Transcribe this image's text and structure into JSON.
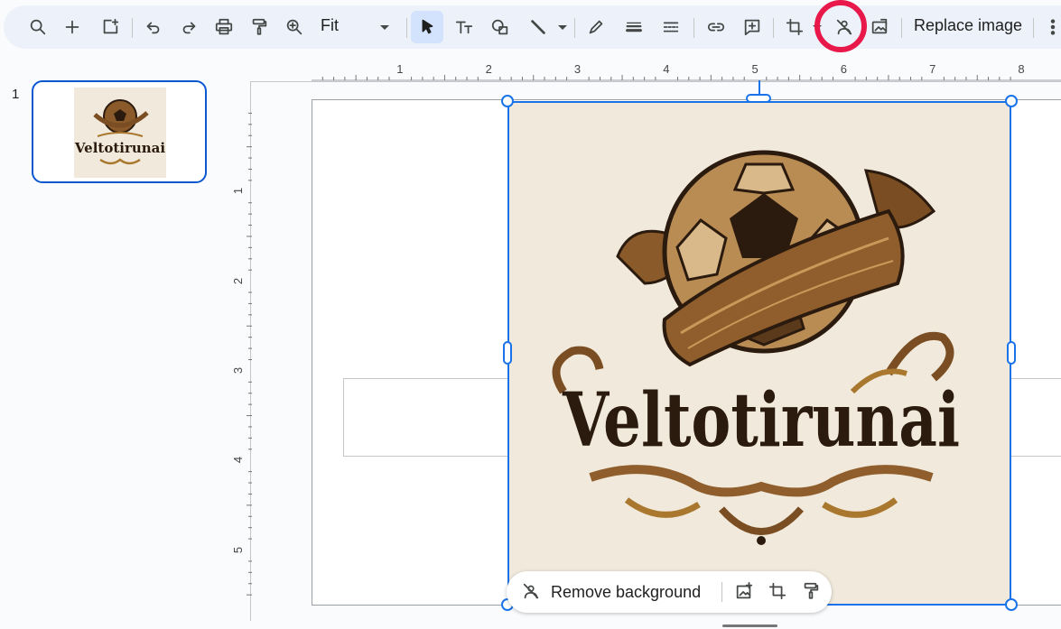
{
  "toolbar": {
    "zoom_value": "Fit",
    "replace_image_label": "Replace image",
    "icons": [
      "search-icon",
      "add-icon",
      "new-slide-icon",
      "undo-icon",
      "redo-icon",
      "print-icon",
      "paint-format-icon",
      "zoom-icon",
      "select-icon",
      "text-box-icon",
      "shape-icon",
      "line-icon",
      "pen-icon",
      "line-weight-icon",
      "line-dash-icon",
      "link-icon",
      "comment-icon",
      "crop-icon",
      "remove-background-icon",
      "replace-image-icon",
      "more-icon"
    ]
  },
  "filmstrip": {
    "slides": [
      {
        "number": "1",
        "logo_text": "Veltotirunai"
      }
    ]
  },
  "rulers": {
    "horizontal": [
      "1",
      "2",
      "3",
      "4",
      "5",
      "6",
      "7",
      "8"
    ],
    "vertical": [
      "1",
      "2",
      "3",
      "4",
      "5"
    ]
  },
  "image": {
    "logo_text": "Veltotirunai",
    "colors": {
      "background": "#f1eadc",
      "brown_dark": "#2b1a0e",
      "gold": "#a9782e",
      "selection": "#1a73e8"
    }
  },
  "floating_toolbar": {
    "remove_background_label": "Remove background"
  },
  "highlight_color": "#e8194a"
}
